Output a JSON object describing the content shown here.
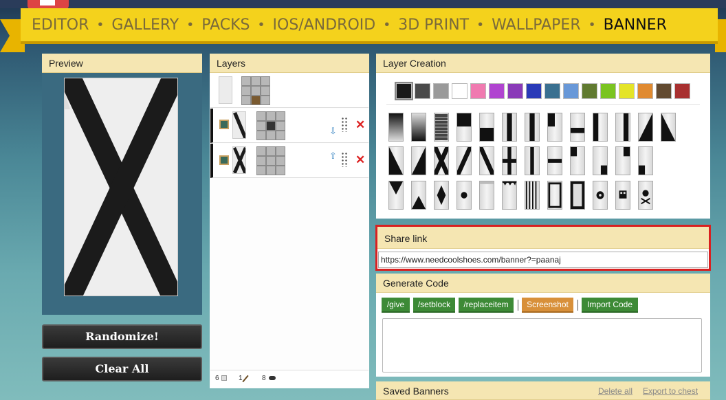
{
  "nav": {
    "items": [
      "EDITOR",
      "GALLERY",
      "PACKS",
      "IOS/ANDROID",
      "3D PRINT",
      "WALLPAPER",
      "BANNER"
    ],
    "active": "BANNER"
  },
  "preview": {
    "title": "Preview"
  },
  "buttons": {
    "randomize": "Randomize!",
    "clear_all": "Clear All"
  },
  "layers": {
    "title": "Layers",
    "footer": {
      "wool_count": "6",
      "stick_count": "1",
      "dye_count": "8"
    }
  },
  "layer_creation": {
    "title": "Layer Creation",
    "colors": [
      "#1a1a1a",
      "#4a4a4a",
      "#9a9a9a",
      "#ffffff",
      "#f07ab0",
      "#b044d0",
      "#8a3ab8",
      "#2a3ab8",
      "#3a7090",
      "#6898d8",
      "#607a30",
      "#7ac420",
      "#e4e428",
      "#e08a30",
      "#624a30",
      "#a83030"
    ],
    "selected_color": "#1a1a1a"
  },
  "share": {
    "title": "Share link",
    "url": "https://www.needcoolshoes.com/banner?=paanaj"
  },
  "generate": {
    "title": "Generate Code",
    "buttons": [
      "/give",
      "/setblock",
      "/replaceitem",
      "Screenshot",
      "Import Code"
    ],
    "textarea_value": ""
  },
  "saved": {
    "title": "Saved Banners",
    "delete_all": "Delete all",
    "export": "Export to chest"
  }
}
